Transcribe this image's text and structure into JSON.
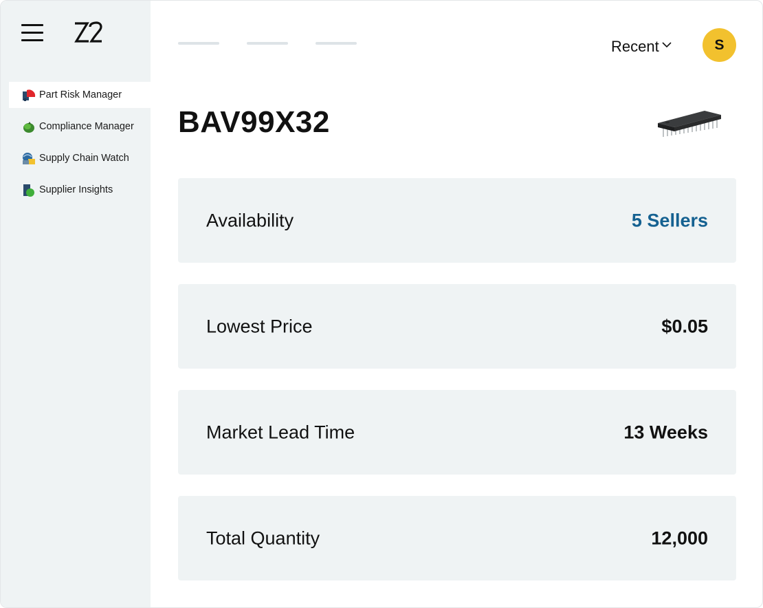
{
  "sidebar": {
    "logo_text": "Z2",
    "items": [
      {
        "label": "Part Risk Manager",
        "icon": "part-risk-icon",
        "active": true
      },
      {
        "label": "Compliance Manager",
        "icon": "compliance-icon",
        "active": false
      },
      {
        "label": "Supply Chain Watch",
        "icon": "supply-chain-icon",
        "active": false
      },
      {
        "label": "Supplier Insights",
        "icon": "supplier-insights-icon",
        "active": false
      }
    ]
  },
  "header": {
    "recent_label": "Recent",
    "avatar_initial": "S"
  },
  "part": {
    "number": "BAV99X32",
    "image_icon": "ic-chip-icon"
  },
  "cards": [
    {
      "label": "Availability",
      "value": "5 Sellers",
      "is_link": true
    },
    {
      "label": "Lowest Price",
      "value": "$0.05",
      "is_link": false
    },
    {
      "label": "Market Lead Time",
      "value": "13 Weeks",
      "is_link": false
    },
    {
      "label": "Total Quantity",
      "value": "12,000",
      "is_link": false
    }
  ],
  "colors": {
    "sidebar_bg": "#eff3f4",
    "card_bg": "#eff3f4",
    "link_blue": "#156191",
    "avatar_yellow": "#f2c12e"
  }
}
